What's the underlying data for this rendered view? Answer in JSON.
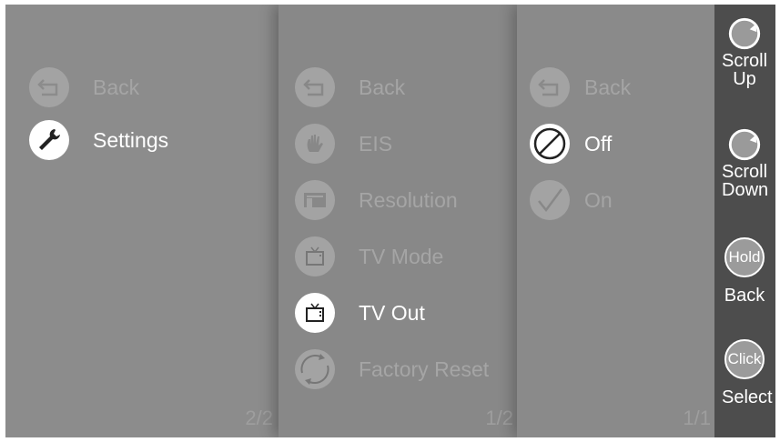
{
  "menu_settings": {
    "back_label": "Back",
    "settings_label": "Settings",
    "pager": "2/2"
  },
  "menu_main": {
    "back_label": "Back",
    "eis_label": "EIS",
    "resolution_label": "Resolution",
    "tv_mode_label": "TV Mode",
    "tv_out_label": "TV Out",
    "factory_reset_label": "Factory Reset",
    "pager": "1/2"
  },
  "menu_tvout": {
    "back_label": "Back",
    "off_label": "Off",
    "on_label": "On",
    "pager": "1/1"
  },
  "sidebar": {
    "scroll_up_line1": "Scroll",
    "scroll_up_line2": "Up",
    "scroll_down_line1": "Scroll",
    "scroll_down_line2": "Down",
    "hold_badge": "Hold",
    "back_label": "Back",
    "click_badge": "Click",
    "select_label": "Select"
  },
  "colors": {
    "selected": "#ffffff",
    "dimmed": "#a5a5a5",
    "sidebar_bg": "#4d4d4d"
  },
  "icons": [
    "back-arrow-icon",
    "wrench-icon",
    "hand-stabilize-icon",
    "resolution-icon",
    "tv-icon",
    "refresh-cycle-icon",
    "slash-circle-icon",
    "checkmark-icon",
    "rotate-icon"
  ]
}
